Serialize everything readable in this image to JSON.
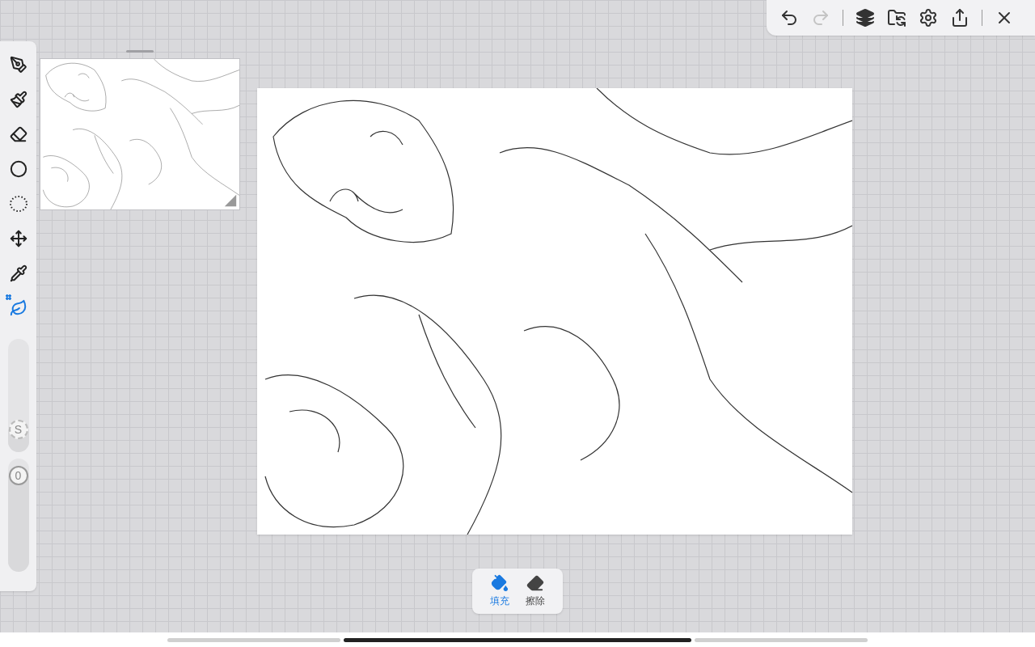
{
  "top_toolbar": {
    "undo": {
      "disabled": false
    },
    "redo": {
      "disabled": true
    }
  },
  "tools": [
    {
      "kind": "pen",
      "selected": false
    },
    {
      "kind": "brush",
      "selected": false
    },
    {
      "kind": "eraser",
      "selected": false
    },
    {
      "kind": "shape",
      "selected": false
    },
    {
      "kind": "lasso",
      "selected": false
    },
    {
      "kind": "move",
      "selected": false
    },
    {
      "kind": "eyedropper",
      "selected": false
    },
    {
      "kind": "fill",
      "selected": true
    }
  ],
  "sliders": [
    {
      "kind": "size",
      "thumb": "S",
      "level": 0.2
    },
    {
      "kind": "opacity",
      "thumb": "0",
      "level": 0.85
    }
  ],
  "fill_modes": [
    {
      "kind": "fill",
      "label": "填充",
      "selected": true
    },
    {
      "kind": "erase",
      "label": "擦除",
      "selected": false
    }
  ]
}
